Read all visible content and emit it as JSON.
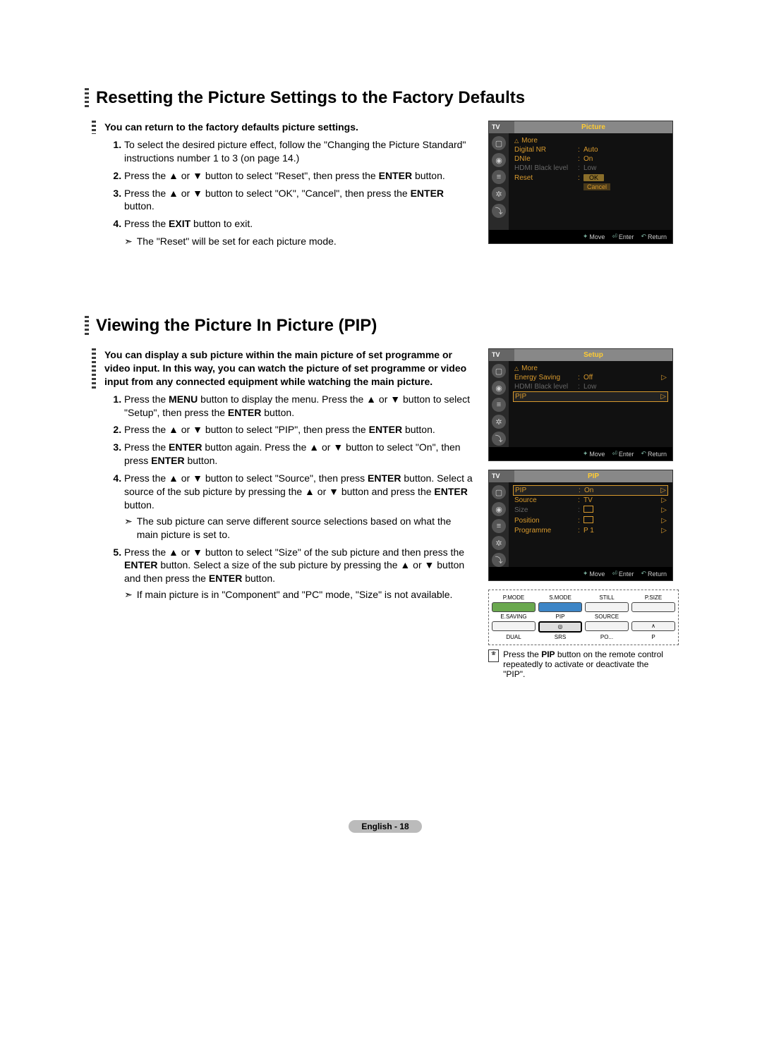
{
  "section1": {
    "heading": "Resetting the Picture Settings to the Factory Defaults",
    "intro": "You can return to the factory defaults picture settings.",
    "steps": [
      "To select the desired picture effect, follow the \"Changing the Picture Standard\" instructions number 1 to 3 (on page 14.)",
      "Press the ▲ or ▼ button to select \"Reset\", then press the ENTER button.",
      "Press the ▲ or ▼ button to select \"OK\", \"Cancel\", then press the ENTER button.",
      "Press the EXIT button to exit."
    ],
    "note": "The \"Reset\" will be set for each picture mode."
  },
  "section2": {
    "heading": "Viewing the Picture In Picture (PIP)",
    "intro": "You can display a sub picture within the main picture of set programme or video input. In this way, you can watch the picture of set programme or video input from any connected equipment while watching the main picture.",
    "steps": [
      "Press the MENU button to display the menu. Press the ▲ or ▼ button to select \"Setup\", then press the ENTER button.",
      "Press the ▲ or ▼ button to select \"PIP\", then press the ENTER button.",
      "Press the ENTER button again. Press the ▲ or ▼ button to select \"On\", then press ENTER button.",
      "Press the ▲ or ▼ button to select \"Source\", then press ENTER button. Select a source of the sub picture by pressing the ▲ or ▼ button and press the ENTER button.",
      "Press the ▲ or ▼ button to select \"Size\" of the sub picture and then press the ENTER button. Select a size of the sub picture by pressing the ▲ or ▼ button and then press the ENTER button."
    ],
    "note4": "The sub picture can serve different source selections based on what the main picture is set to.",
    "note5": "If main picture is in \"Component\" and \"PC\" mode, \"Size\" is not available."
  },
  "osd1": {
    "tv": "TV",
    "title": "Picture",
    "rows": {
      "more": "More",
      "digitalnr_l": "Digital NR",
      "digitalnr_v": "Auto",
      "dnie_l": "DNIe",
      "dnie_v": "On",
      "hdmi_l": "HDMI Black level",
      "hdmi_v": "Low",
      "reset_l": "Reset",
      "ok": "OK",
      "cancel": "Cancel"
    },
    "foot": {
      "move": "Move",
      "enter": "Enter",
      "ret": "Return"
    }
  },
  "osd2": {
    "tv": "TV",
    "title": "Setup",
    "rows": {
      "more": "More",
      "energy_l": "Energy Saving",
      "energy_v": "Off",
      "hdmi_l": "HDMI Black level",
      "hdmi_v": "Low",
      "pip_l": "PIP"
    },
    "foot": {
      "move": "Move",
      "enter": "Enter",
      "ret": "Return"
    }
  },
  "osd3": {
    "tv": "TV",
    "title": "PIP",
    "rows": {
      "pip_l": "PIP",
      "pip_v": "On",
      "source_l": "Source",
      "source_v": "TV",
      "size_l": "Size",
      "position_l": "Position",
      "programme_l": "Programme",
      "programme_v": "P 1"
    },
    "foot": {
      "move": "Move",
      "enter": "Enter",
      "ret": "Return"
    }
  },
  "remote": {
    "labels": [
      "P.MODE",
      "S.MODE",
      "STILL",
      "P.SIZE",
      "E.SAVING",
      "PIP",
      "SOURCE",
      "",
      "DUAL",
      "SRS",
      "PO...",
      "P"
    ]
  },
  "remote_note": "Press the PIP button on the remote control repeatedly to activate or deactivate the \"PIP\".",
  "page_footer": "English - 18"
}
